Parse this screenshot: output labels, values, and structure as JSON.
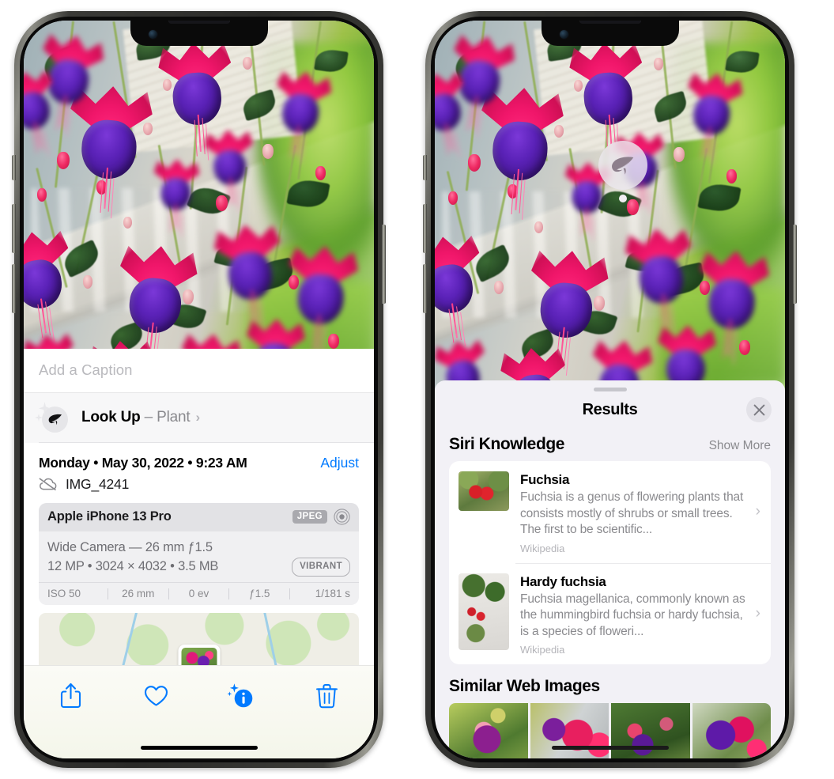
{
  "colors": {
    "accent_blue": "#007aff",
    "sheet_bg": "#f2f1f6",
    "card_bg": "#ffffff",
    "secondary_text": "#8a8a8e"
  },
  "left_phone": {
    "caption": {
      "placeholder": "Add a Caption",
      "value": ""
    },
    "lookup": {
      "icon": "leaf-icon",
      "label": "Look Up",
      "dash": " – ",
      "subject": "Plant",
      "chevron": "›"
    },
    "metadata": {
      "date_line": "Monday • May 30, 2022 • 9:23 AM",
      "adjust_label": "Adjust",
      "cloud_icon": "icloud-slash-icon",
      "filename": "IMG_4241"
    },
    "camera_card": {
      "device": "Apple iPhone 13 Pro",
      "format_badge": "JPEG",
      "aperture_icon": "camera-aperture-icon",
      "lens_line": "Wide Camera — 26 mm ƒ1.5",
      "size_line": "12 MP • 3024 × 4032 • 3.5 MB",
      "style_badge": "VIBRANT",
      "exif": [
        "ISO 50",
        "26 mm",
        "0 ev",
        "ƒ1.5",
        "1/181 s"
      ]
    },
    "toolbar": [
      {
        "name": "share-button",
        "icon": "share-icon"
      },
      {
        "name": "favorite-button",
        "icon": "heart-icon"
      },
      {
        "name": "info-button",
        "icon": "info-sparkle-icon"
      },
      {
        "name": "delete-button",
        "icon": "trash-icon"
      }
    ]
  },
  "right_phone": {
    "photo_badge": {
      "icon": "leaf-icon"
    },
    "sheet": {
      "title": "Results",
      "close_icon": "close-icon",
      "grabber": "drag-handle"
    },
    "siri_knowledge": {
      "title": "Siri Knowledge",
      "show_more": "Show More",
      "items": [
        {
          "title": "Fuchsia",
          "description": "Fuchsia is a genus of flowering plants that consists mostly of shrubs or small trees. The first to be scientific...",
          "source": "Wikipedia",
          "chevron": "›"
        },
        {
          "title": "Hardy fuchsia",
          "description": "Fuchsia magellanica, commonly known as the hummingbird fuchsia or hardy fuchsia, is a species of floweri...",
          "source": "Wikipedia",
          "chevron": "›"
        }
      ]
    },
    "similar_web_images": {
      "title": "Similar Web Images",
      "thumbnails": [
        "fuchsia-thumb-1",
        "fuchsia-thumb-2",
        "fuchsia-thumb-3",
        "fuchsia-thumb-4"
      ]
    }
  }
}
